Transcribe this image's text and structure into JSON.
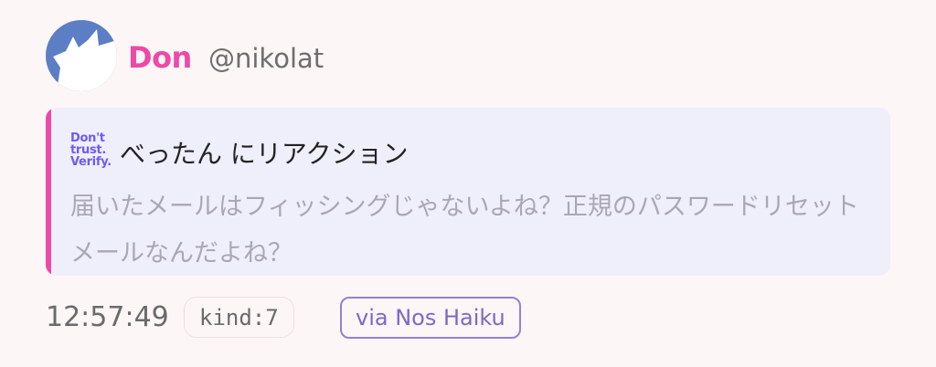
{
  "author": {
    "display_name": "Don",
    "handle": "@nikolat",
    "avatar_icon": "cat-silhouette-avatar"
  },
  "quote": {
    "badge_lines": [
      "Don't",
      "trust.",
      "Verify."
    ],
    "title": "べったん にリアクション",
    "body": "届いたメールはフィッシングじゃないよね？正規のパスワードリセットメールなんだよね？"
  },
  "meta": {
    "timestamp": "12:57:49",
    "kind": "kind:7",
    "via": "via Nos Haiku"
  },
  "colors": {
    "accent_pink": "#ec4aa6",
    "card_background": "#efeefb",
    "via_border": "#9382cf",
    "avatar_blue": "#5b7ec4"
  }
}
